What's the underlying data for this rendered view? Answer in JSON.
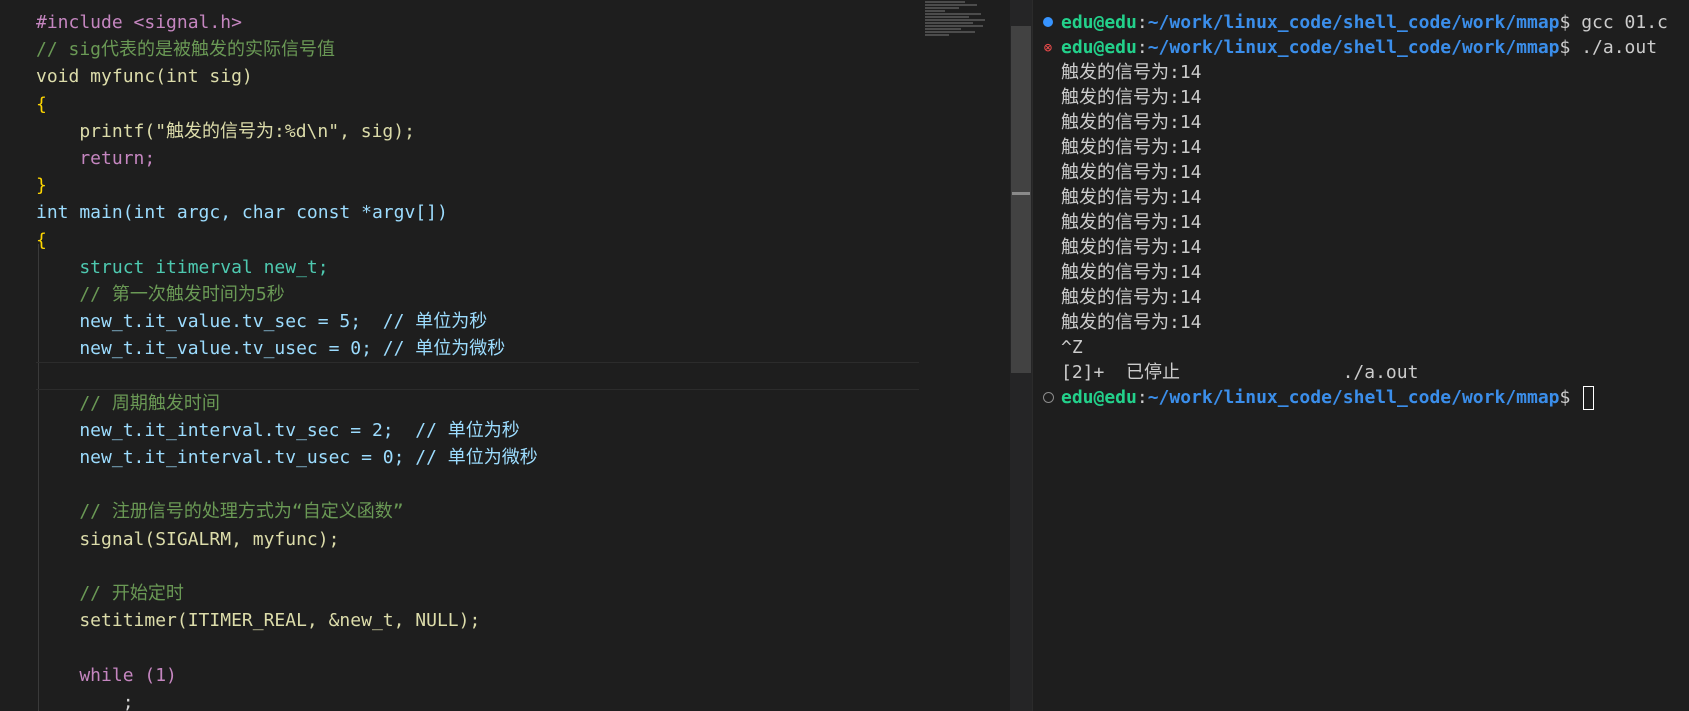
{
  "editor": {
    "code_lines": [
      "#include <signal.h>",
      "// sig代表的是被触发的实际信号值",
      "void myfunc(int sig)",
      "{",
      "    printf(\"触发的信号为:%d\\n\", sig);",
      "    return;",
      "}",
      "int main(int argc, char const *argv[])",
      "{",
      "    struct itimerval new_t;",
      "    // 第一次触发时间为5秒",
      "    new_t.it_value.tv_sec = 5;  // 单位为秒",
      "    new_t.it_value.tv_usec = 0; // 单位为微秒",
      "",
      "    // 周期触发时间",
      "    new_t.it_interval.tv_sec = 2;  // 单位为秒",
      "    new_t.it_interval.tv_usec = 0; // 单位为微秒",
      "",
      "    // 注册信号的处理方式为“自定义函数”",
      "    signal(SIGALRM, myfunc);",
      "",
      "    // 开始定时",
      "    setitimer(ITIMER_REAL, &new_t, NULL);",
      "",
      "    while (1)",
      "        ;"
    ]
  },
  "terminal": {
    "prompt_user": "edu@edu",
    "prompt_path": "~/work/linux_code/shell_code/work/mmap",
    "prompt_symbol": "$",
    "commands": [
      " gcc 01.c",
      " ./a.out"
    ],
    "output_lines": [
      "触发的信号为:14",
      "触发的信号为:14",
      "触发的信号为:14",
      "触发的信号为:14",
      "触发的信号为:14",
      "触发的信号为:14",
      "触发的信号为:14",
      "触发的信号为:14",
      "触发的信号为:14",
      "触发的信号为:14",
      "触发的信号为:14",
      "^Z",
      "[2]+  已停止               ./a.out"
    ],
    "status_colors": {
      "success": "#3794ff",
      "error": "#f14c4c",
      "idle": "#8b8b8b"
    }
  }
}
